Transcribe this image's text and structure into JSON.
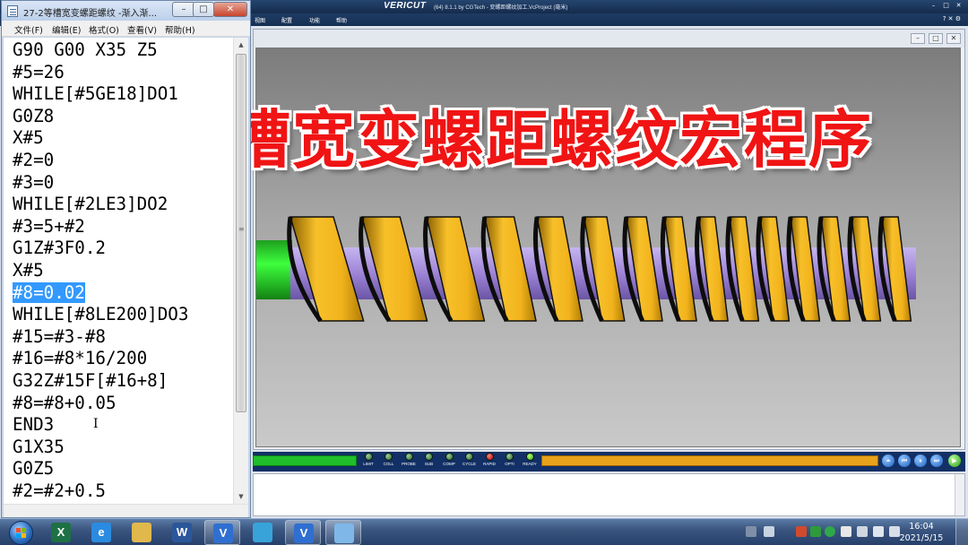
{
  "vericut": {
    "logo": "VERICUT",
    "version": "(64)  8.1.1 by CGTech - 变螺距螺纹加工.VcProject (毫米)",
    "menus": [
      "视图",
      "配置",
      "功能",
      "帮助"
    ],
    "leds": [
      {
        "label": "LIMIT",
        "state": "off"
      },
      {
        "label": "COLL",
        "state": "off"
      },
      {
        "label": "PROBE",
        "state": "off"
      },
      {
        "label": "SUB",
        "state": "off"
      },
      {
        "label": "COMP",
        "state": "off"
      },
      {
        "label": "CYCLE",
        "state": "off"
      },
      {
        "label": "RAPID",
        "state": "red"
      },
      {
        "label": "OPTI",
        "state": "off"
      },
      {
        "label": "READY",
        "state": "green"
      }
    ],
    "colors": {
      "thread": "#f2b31c",
      "core": "#9e84d6",
      "stock": "#2ad62a",
      "status_bar": "#123066"
    }
  },
  "overlay": {
    "headline": "等槽宽变螺距螺纹宏程序"
  },
  "notepad": {
    "title": "27-2等槽宽变螺距螺纹 -渐入渐...",
    "menus": [
      "文件(F)",
      "编辑(E)",
      "格式(O)",
      "查看(V)",
      "帮助(H)"
    ],
    "selected_line": 11,
    "lines": [
      "G90 G00 X35 Z5",
      "#5=26",
      "WHILE[#5GE18]DO1",
      "G0Z8",
      "X#5",
      "#2=0",
      "#3=0",
      "WHILE[#2LE3]DO2",
      "#3=5+#2",
      "G1Z#3F0.2",
      "X#5",
      "#8=0.02",
      "WHILE[#8LE200]DO3",
      "#15=#3-#8",
      "#16=#8*16/200",
      "G32Z#15F[#16+8]",
      "#8=#8+0.05",
      "END3",
      "G1X35",
      "G0Z5",
      "#2=#2+0.5"
    ]
  },
  "taskbar": {
    "apps": [
      {
        "name": "excel",
        "glyph": "X",
        "color": "#1e7145"
      },
      {
        "name": "ie",
        "glyph": "e",
        "color": "#2b8be0"
      },
      {
        "name": "explorer",
        "glyph": "",
        "color": "#e0b84c"
      },
      {
        "name": "word",
        "glyph": "W",
        "color": "#2b579a"
      },
      {
        "name": "vericut-1",
        "glyph": "V",
        "color": "#2f6fd1"
      },
      {
        "name": "tool",
        "glyph": "",
        "color": "#37a3d9"
      },
      {
        "name": "vericut-2",
        "glyph": "V",
        "color": "#2f6fd1"
      },
      {
        "name": "notepad",
        "glyph": "",
        "color": "#7fb8e8"
      }
    ],
    "time": "16:04",
    "date": "2021/5/15"
  }
}
